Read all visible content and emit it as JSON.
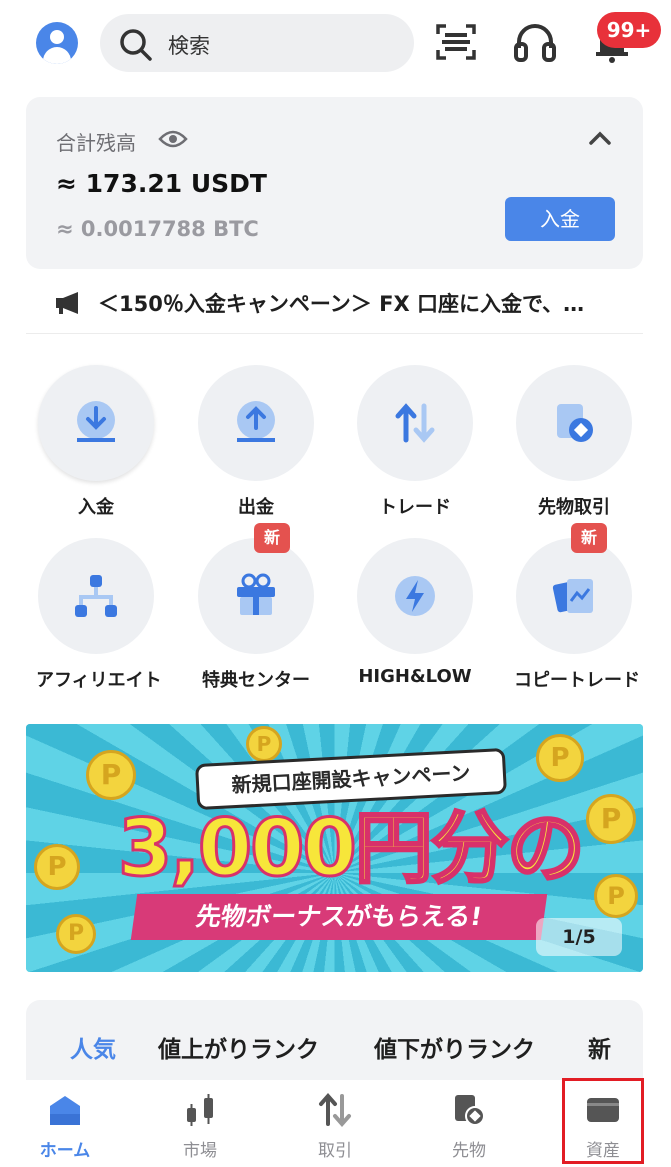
{
  "header": {
    "search_placeholder": "検索",
    "notification_count": "99+"
  },
  "balance": {
    "title": "合計残高",
    "main_value": "≈ 173.21 USDT",
    "sub_value": "≈ 0.0017788 BTC",
    "deposit_label": "入金"
  },
  "announcement": {
    "text": "＜150％入金キャンペーン＞ FX 口座に入金で、…"
  },
  "quick_actions": [
    {
      "label": "入金",
      "icon": "deposit-icon"
    },
    {
      "label": "出金",
      "icon": "withdraw-icon"
    },
    {
      "label": "トレード",
      "icon": "trade-icon"
    },
    {
      "label": "先物取引",
      "icon": "futures-icon"
    },
    {
      "label": "アフィリエイト",
      "icon": "affiliate-icon"
    },
    {
      "label": "特典センター",
      "icon": "gift-icon",
      "badge": "新"
    },
    {
      "label": "HIGH&LOW",
      "icon": "lightning-icon"
    },
    {
      "label": "コピートレード",
      "icon": "copy-trade-icon",
      "badge": "新"
    }
  ],
  "banner": {
    "campaign": "新規口座開設キャンペーン",
    "amount": "3,000円分の",
    "bonus": "先物ボーナスがもらえる!",
    "page_indicator": "1/5",
    "coin_letter": "P"
  },
  "ranking_tabs": [
    "人気",
    "値上がりランク",
    "値下がりランク",
    "新"
  ],
  "bottom_nav": [
    {
      "label": "ホーム",
      "active": true
    },
    {
      "label": "市場",
      "active": false
    },
    {
      "label": "取引",
      "active": false
    },
    {
      "label": "先物",
      "active": false
    },
    {
      "label": "資産",
      "active": false
    }
  ],
  "colors": {
    "accent": "#4a86e8",
    "badge_red": "#e8313a",
    "highlight_red": "#e21c24"
  }
}
